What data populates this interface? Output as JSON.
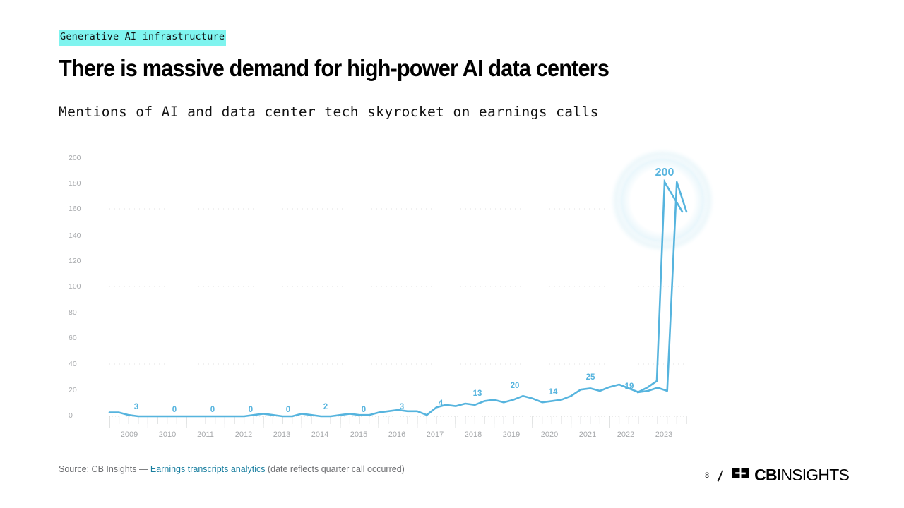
{
  "header": {
    "eyebrow": "Generative AI infrastructure",
    "headline": "There is massive demand for high-power AI data centers",
    "subhead": "Mentions of AI and data center tech skyrocket on earnings calls"
  },
  "footer": {
    "source_prefix": "Source: CB Insights — ",
    "source_link": "Earnings transcripts analytics",
    "source_suffix": " (date reflects quarter call occurred)",
    "page_number": "8",
    "brand_bold": "CB",
    "brand_light": "INSIGHTS"
  },
  "colors": {
    "line": "#56b4de",
    "label": "#56b4de",
    "axis_text": "#a7a9ac",
    "highlight_tag": "#7ff4ef",
    "link": "#1a7fa0",
    "grid": "#dcdcdc"
  },
  "chart_data": {
    "type": "line",
    "title": "Mentions of AI and data center tech skyrocket on earnings calls",
    "xlabel": "",
    "ylabel": "",
    "ylim": [
      0,
      200
    ],
    "y_ticks": [
      0,
      20,
      40,
      60,
      80,
      100,
      120,
      140,
      160,
      180,
      200
    ],
    "x_ticks": [
      "2009",
      "2010",
      "2011",
      "2012",
      "2013",
      "2014",
      "2015",
      "2016",
      "2017",
      "2018",
      "2019",
      "2020",
      "2021",
      "2022",
      "2023"
    ],
    "grid": "faint dotted horizontal at 40, 100, 160",
    "legend": "none",
    "x_tick_minor": "quarterly",
    "annotations": [
      {
        "label": "200",
        "note": "peak highlighted with glow circle",
        "x": "2023 Q4",
        "value": 200
      }
    ],
    "point_labels": [
      {
        "x": "2009",
        "value": 3
      },
      {
        "x": "2010",
        "value": 0
      },
      {
        "x": "2011",
        "value": 0
      },
      {
        "x": "2012",
        "value": 0
      },
      {
        "x": "2013",
        "value": 0
      },
      {
        "x": "2014",
        "value": 2
      },
      {
        "x": "2015",
        "value": 0
      },
      {
        "x": "2016",
        "value": 3
      },
      {
        "x": "2017",
        "value": 4
      },
      {
        "x": "2018",
        "value": 13
      },
      {
        "x": "2019",
        "value": 20
      },
      {
        "x": "2020",
        "value": 14
      },
      {
        "x": "2021",
        "value": 25
      },
      {
        "x": "2022",
        "value": 19
      },
      {
        "x": "2023",
        "value": 200
      }
    ],
    "x": [
      "2009Q1",
      "2009Q2",
      "2009Q3",
      "2009Q4",
      "2010Q1",
      "2010Q2",
      "2010Q3",
      "2010Q4",
      "2011Q1",
      "2011Q2",
      "2011Q3",
      "2011Q4",
      "2012Q1",
      "2012Q2",
      "2012Q3",
      "2012Q4",
      "2013Q1",
      "2013Q2",
      "2013Q3",
      "2013Q4",
      "2014Q1",
      "2014Q2",
      "2014Q3",
      "2014Q4",
      "2015Q1",
      "2015Q2",
      "2015Q3",
      "2015Q4",
      "2016Q1",
      "2016Q2",
      "2016Q3",
      "2016Q4",
      "2017Q1",
      "2017Q2",
      "2017Q3",
      "2017Q4",
      "2018Q1",
      "2018Q2",
      "2018Q3",
      "2018Q4",
      "2019Q1",
      "2019Q2",
      "2019Q3",
      "2019Q4",
      "2020Q1",
      "2020Q2",
      "2020Q3",
      "2020Q4",
      "2021Q1",
      "2021Q2",
      "2021Q3",
      "2021Q4",
      "2022Q1",
      "2022Q2",
      "2022Q3",
      "2022Q4",
      "2023Q1",
      "2023Q2",
      "2023Q3",
      "2023Q4"
    ],
    "values": [
      3,
      3,
      1,
      0,
      0,
      0,
      0,
      0,
      0,
      0,
      0,
      0,
      0,
      0,
      0,
      1,
      2,
      1,
      0,
      0,
      2,
      1,
      0,
      0,
      1,
      2,
      1,
      1,
      3,
      4,
      5,
      4,
      4,
      1,
      7,
      9,
      8,
      10,
      9,
      12,
      13,
      11,
      13,
      16,
      14,
      11,
      12,
      13,
      16,
      21,
      22,
      20,
      23,
      25,
      22,
      19,
      20,
      17,
      19,
      200
    ]
  }
}
